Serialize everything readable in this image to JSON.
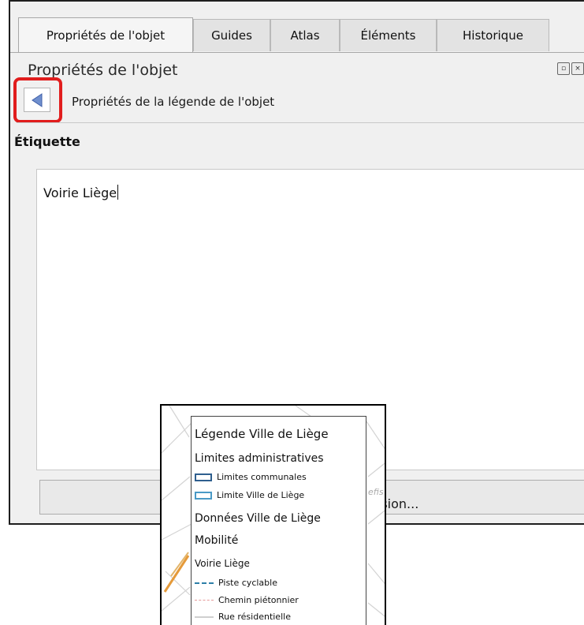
{
  "tabs": [
    {
      "label": "Propriétés de l'objet",
      "active": true
    },
    {
      "label": "Guides",
      "active": false
    },
    {
      "label": "Atlas",
      "active": false
    },
    {
      "label": "Éléments",
      "active": false
    },
    {
      "label": "Historique",
      "active": false
    }
  ],
  "panel": {
    "title": "Propriétés de l'objet",
    "back_icon": "triangle-left-icon",
    "subtitle": "Propriétés de la légende de l'objet",
    "group_label": "Étiquette",
    "label_value": "Voirie Liège",
    "expression_button_label": "ssion..."
  },
  "legend": {
    "title": "Légende Ville de Liège",
    "groups": [
      {
        "heading": "Limites administratives",
        "items": [
          {
            "label": "Limites communales",
            "color": "#2f5f8e"
          },
          {
            "label": "Limite Ville de Liège",
            "color": "#4a9ac6"
          }
        ]
      },
      {
        "heading": "Données Ville de Liège",
        "items": []
      },
      {
        "heading": "Mobilité",
        "items": []
      }
    ],
    "subgroup": "Voirie Liège",
    "lines": [
      {
        "label": "Piste cyclable",
        "color": "#2d7fa8",
        "style": "dashed"
      },
      {
        "label": "Chemin piétonnier",
        "color": "#e69a9a",
        "style": "dashed"
      },
      {
        "label": "Rue résidentielle",
        "color": "#bdbdbd",
        "style": "solid"
      }
    ],
    "map_label": "efis"
  },
  "colors": {
    "highlight": "#e11d1d",
    "back_arrow": "#6f8fce"
  }
}
